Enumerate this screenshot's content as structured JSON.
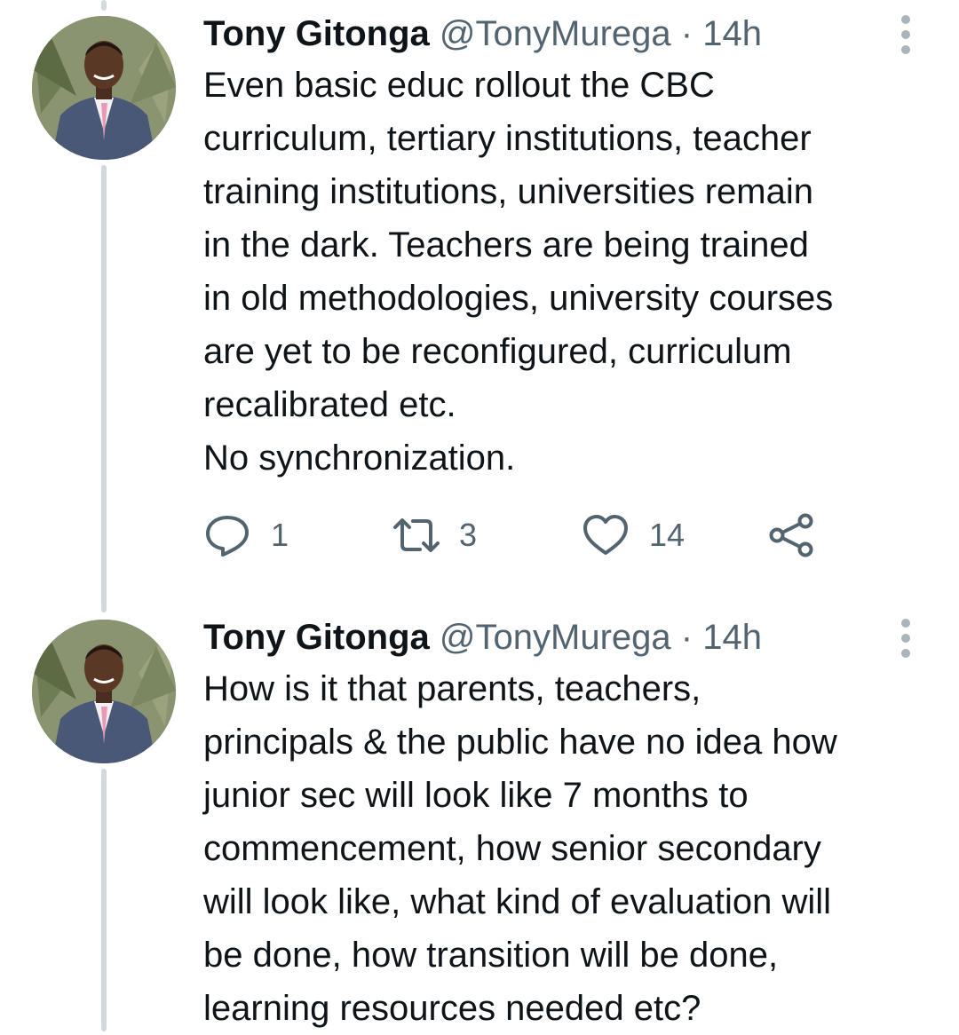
{
  "tweets": [
    {
      "author_name": "Tony Gitonga",
      "handle": "@TonyMurega",
      "separator": "·",
      "time": "14h",
      "text_lines": [
        "Even basic educ rollout the CBC",
        "curriculum, tertiary institutions, teacher",
        "training institutions, universities remain",
        "in the dark. Teachers are being trained",
        "in old methodologies, university courses",
        "are yet to be reconfigured, curriculum",
        "recalibrated etc.",
        "No synchronization."
      ],
      "actions": {
        "reply_count": "1",
        "retweet_count": "3",
        "like_count": "14"
      }
    },
    {
      "author_name": "Tony Gitonga",
      "handle": "@TonyMurega",
      "separator": "·",
      "time": "14h",
      "text_lines": [
        "How is it that parents, teachers,",
        "principals & the public have no idea how",
        "junior sec will look like 7 months to",
        "commencement, how senior secondary",
        "will look like, what kind of evaluation will",
        "be done, how transition will be done,",
        "learning resources needed etc?"
      ]
    }
  ],
  "icons": {
    "reply": "reply-icon",
    "retweet": "retweet-icon",
    "like": "heart-icon",
    "share": "share-icon",
    "more": "more-vertical-icon"
  },
  "colors": {
    "text_primary": "#0f1419",
    "text_secondary": "#536471",
    "thread_line": "#cfd9de"
  }
}
